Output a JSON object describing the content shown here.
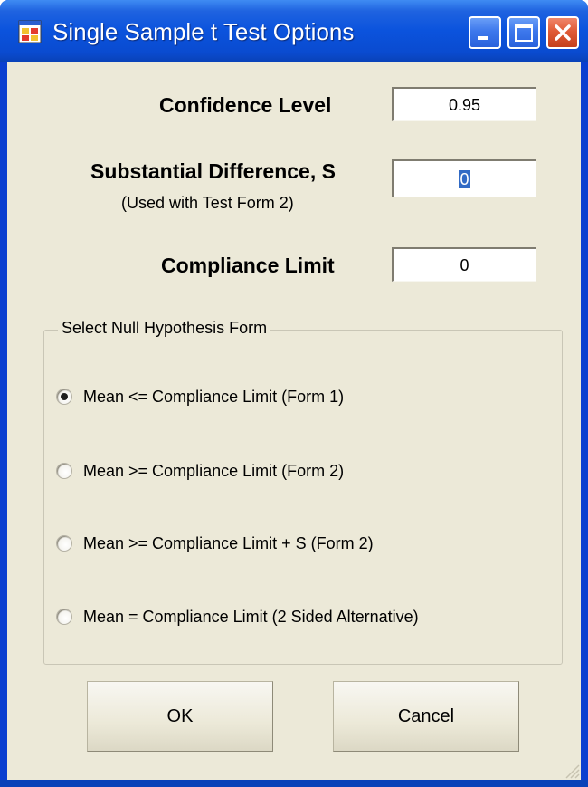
{
  "window": {
    "title": "Single Sample t Test Options"
  },
  "fields": {
    "confidence_label": "Confidence Level",
    "confidence_value": "0.95",
    "substantial_label": "Substantial Difference, S",
    "substantial_note": "(Used with Test Form 2)",
    "substantial_value": "0",
    "compliance_label": "Compliance Limit",
    "compliance_value": "0"
  },
  "group": {
    "legend": "Select Null Hypothesis Form",
    "options": [
      {
        "label": "Mean <= Compliance Limit  (Form 1)",
        "checked": true
      },
      {
        "label": "Mean >= Compliance Limit (Form 2)",
        "checked": false
      },
      {
        "label": "Mean >= Compliance Limit + S  (Form 2)",
        "checked": false
      },
      {
        "label": "Mean = Compliance Limit (2 Sided Alternative)",
        "checked": false
      }
    ]
  },
  "buttons": {
    "ok": "OK",
    "cancel": "Cancel"
  },
  "icons": {
    "app": "app-window-icon",
    "minimize": "minimize-icon",
    "maximize": "maximize-icon",
    "close": "close-icon",
    "grip": "resize-grip-icon"
  },
  "colors": {
    "titlebar": "#0b53dd",
    "client": "#ece9d8",
    "close_button": "#e05a36",
    "selection": "#316ac5"
  }
}
